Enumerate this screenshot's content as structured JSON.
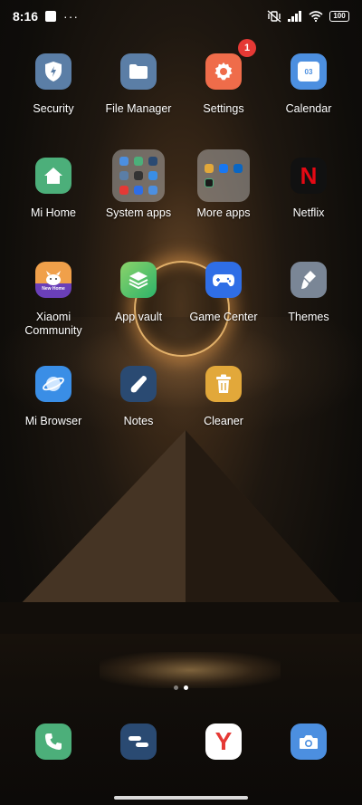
{
  "status_bar": {
    "time": "8:16",
    "more": "···",
    "battery": "100"
  },
  "apps": {
    "security": {
      "label": "Security",
      "color": "#5b7ea6"
    },
    "file_manager": {
      "label": "File Manager",
      "color": "#5b7ea6"
    },
    "settings": {
      "label": "Settings",
      "color": "#ef6c4a",
      "badge": "1"
    },
    "calendar": {
      "label": "Calendar",
      "color": "#4c8fe0",
      "date": "03"
    },
    "mi_home": {
      "label": "Mi Home",
      "color": "#4caf7a"
    },
    "system_apps": {
      "label": "System apps"
    },
    "more_apps": {
      "label": "More apps"
    },
    "netflix": {
      "label": "Netflix",
      "color": "#111111",
      "glyph": "N"
    },
    "xiaomi_community": {
      "label": "Xiaomi Community",
      "banner": "New Home"
    },
    "app_vault": {
      "label": "App vault"
    },
    "game_center": {
      "label": "Game Center",
      "color": "#2f6ee6"
    },
    "themes": {
      "label": "Themes",
      "color": "#7a8696"
    },
    "mi_browser": {
      "label": "Mi Browser",
      "color": "#3a8ee6"
    },
    "notes": {
      "label": "Notes",
      "color": "#2a4a72"
    },
    "cleaner": {
      "label": "Cleaner",
      "color": "#e2a83a"
    }
  },
  "dock": {
    "phone": {
      "color": "#4caf7a"
    },
    "messages": {
      "color": "#2a4a72"
    },
    "yandex": {
      "color": "#ffffff",
      "glyph": "Y"
    },
    "camera": {
      "color": "#4c8fe0"
    }
  },
  "pages": {
    "count": 2,
    "active": 1
  }
}
